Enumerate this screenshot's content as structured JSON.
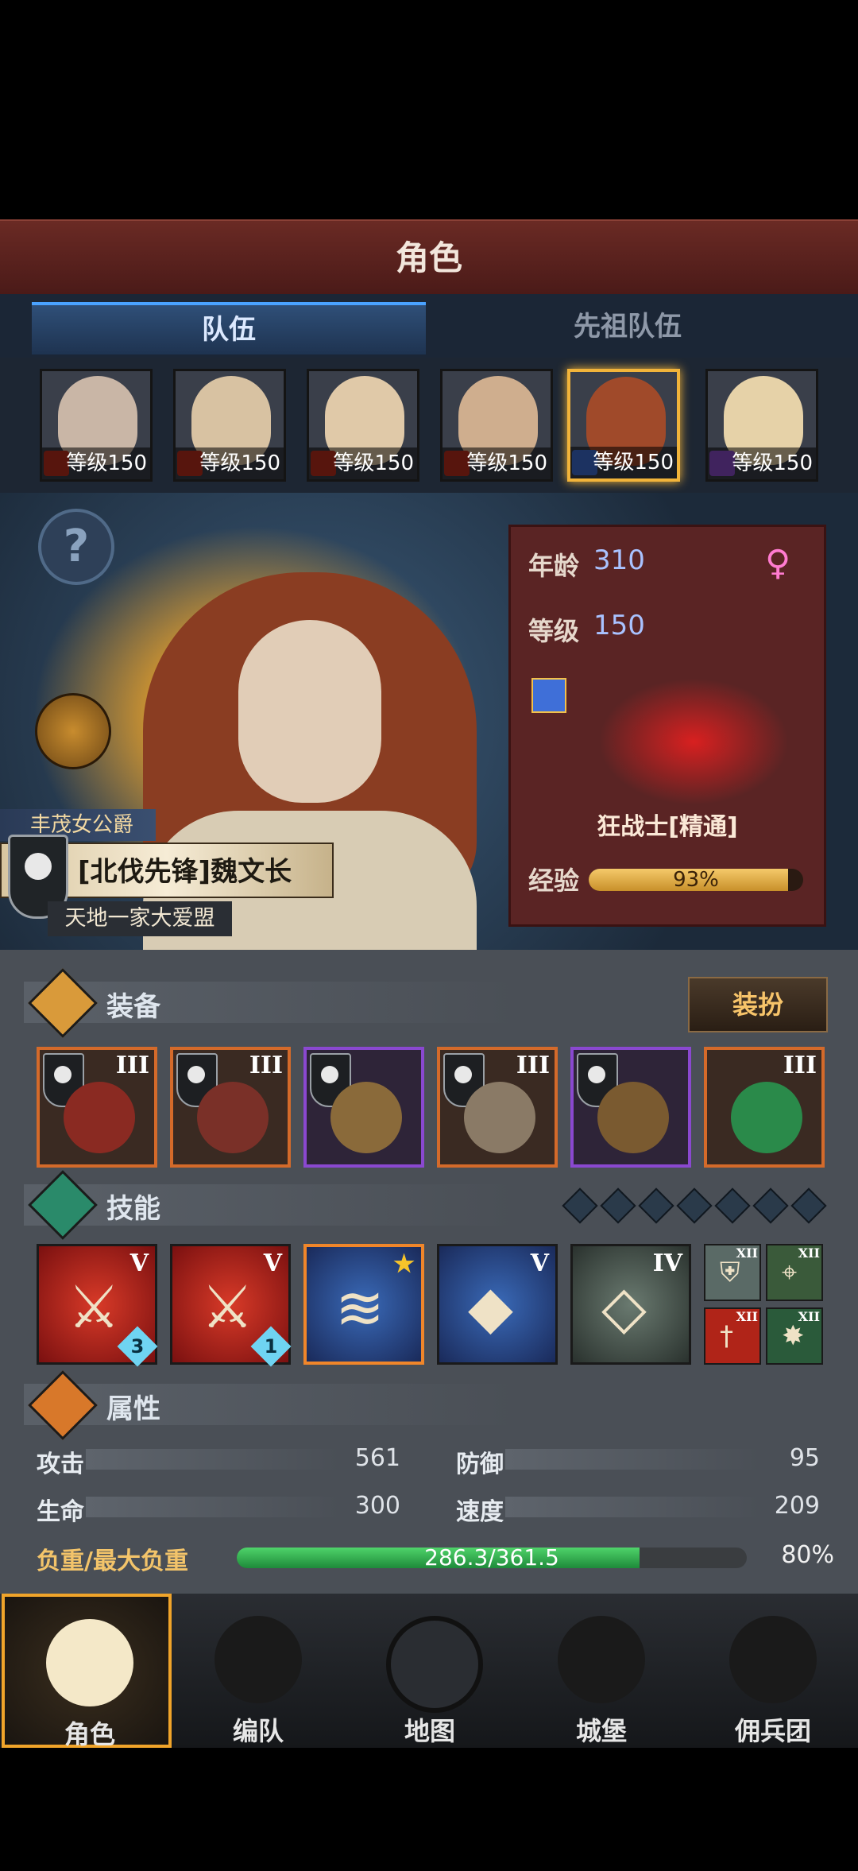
{
  "header": {
    "title": "角色"
  },
  "tabs": [
    {
      "label": "队伍"
    },
    {
      "label": "先祖队伍"
    }
  ],
  "roster": [
    {
      "level": "等级150",
      "class_color": "#c0301e"
    },
    {
      "level": "等级150",
      "class_color": "#c0301e"
    },
    {
      "level": "等级150",
      "class_color": "#c0301e"
    },
    {
      "level": "等级150",
      "class_color": "#c0301e"
    },
    {
      "level": "等级150",
      "class_color": "#3f6fd8"
    },
    {
      "level": "等级150",
      "class_color": "#8f4fd0"
    }
  ],
  "hero": {
    "title_tag": "丰茂女公爵",
    "name": "[北伐先锋]魏文长",
    "guild": "天地一家大爱盟"
  },
  "stats_panel": {
    "age_label": "年龄",
    "age_value": "310",
    "level_label": "等级",
    "level_value": "150",
    "gender_icon": "♀",
    "class_name": "狂战士[精通]",
    "exp_label": "经验",
    "exp_percent": "93%",
    "exp_fraction": 0.93
  },
  "equipment": {
    "title": "装备",
    "dress_button": "装扮",
    "slots": [
      {
        "tier": "III",
        "rarity": "orange"
      },
      {
        "tier": "III",
        "rarity": "orange"
      },
      {
        "tier": "",
        "rarity": "purple"
      },
      {
        "tier": "III",
        "rarity": "orange"
      },
      {
        "tier": "",
        "rarity": "purple"
      },
      {
        "tier": "III",
        "rarity": "orange"
      }
    ]
  },
  "skills": {
    "title": "技能",
    "slots": [
      {
        "tier": "V",
        "count": "3",
        "color": "red"
      },
      {
        "tier": "V",
        "count": "1",
        "color": "red"
      },
      {
        "tier": "",
        "count": "",
        "color": "blue",
        "starred": true
      },
      {
        "tier": "V",
        "count": "",
        "color": "blue"
      },
      {
        "tier": "IV",
        "count": "",
        "color": "grey"
      }
    ],
    "mini": [
      {
        "tier": "XII"
      },
      {
        "tier": "XII"
      },
      {
        "tier": "XII"
      },
      {
        "tier": "XII"
      }
    ]
  },
  "attributes": {
    "title": "属性",
    "attack_label": "攻击",
    "attack_value": "561",
    "defense_label": "防御",
    "defense_value": "95",
    "hp_label": "生命",
    "hp_value": "300",
    "speed_label": "速度",
    "speed_value": "209",
    "load_label": "负重/最大负重",
    "load_text": "286.3/361.5",
    "load_percent": "80%",
    "load_fraction": 0.79
  },
  "nav": [
    {
      "label": "角色"
    },
    {
      "label": "编队"
    },
    {
      "label": "地图"
    },
    {
      "label": "城堡"
    },
    {
      "label": "佣兵团"
    }
  ]
}
